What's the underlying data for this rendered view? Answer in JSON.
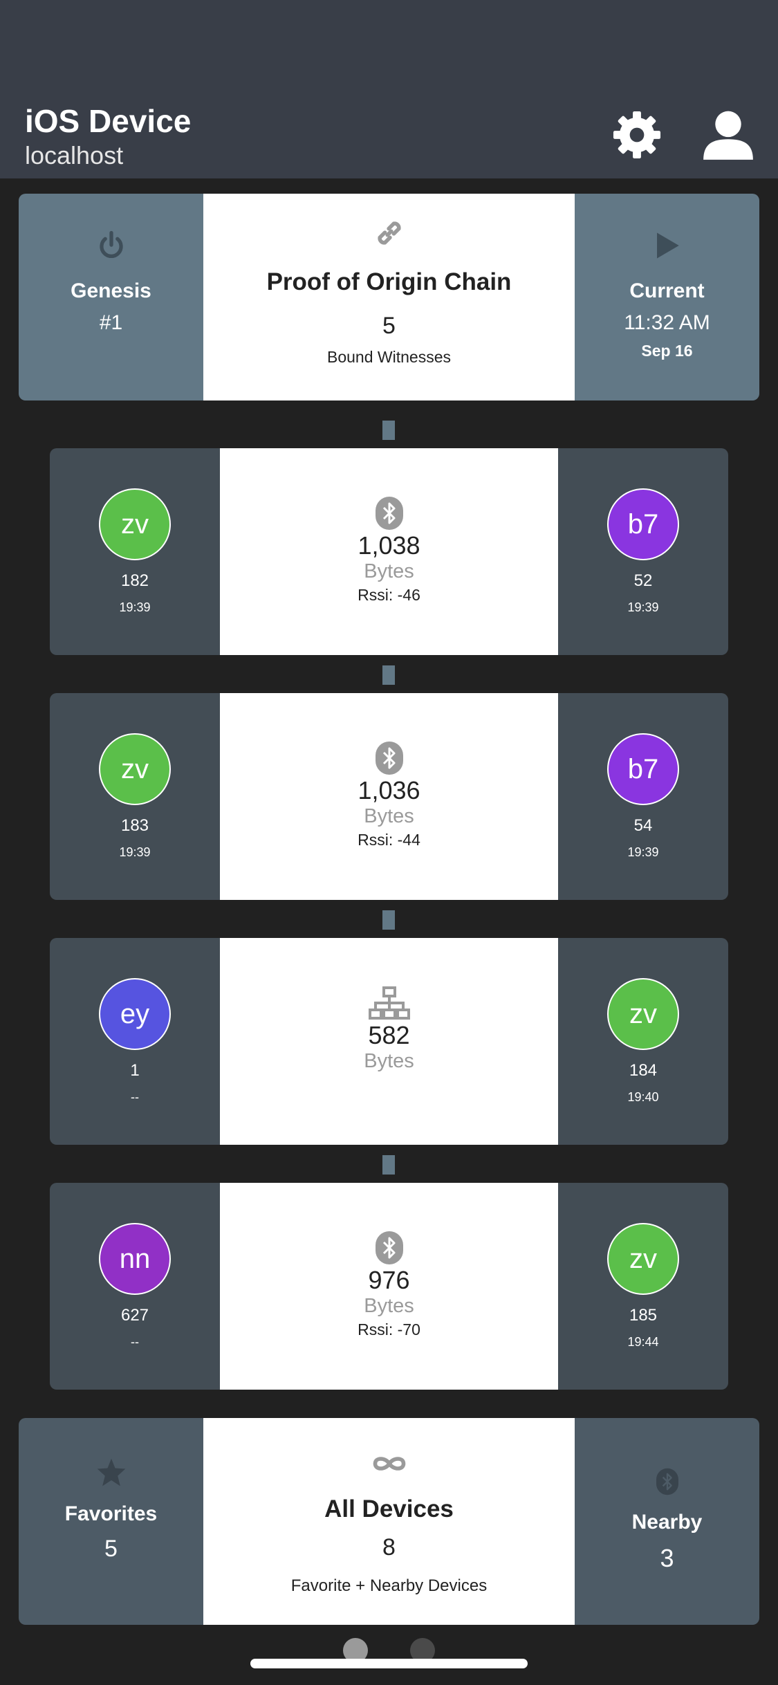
{
  "header": {
    "title": "iOS Device",
    "subtitle": "localhost"
  },
  "chain": {
    "left": {
      "label": "Genesis",
      "value": "#1"
    },
    "center": {
      "title": "Proof of Origin Chain",
      "count": "5",
      "caption": "Bound Witnesses"
    },
    "right": {
      "label": "Current",
      "time": "11:32 AM",
      "date": "Sep 16"
    }
  },
  "witnesses": [
    {
      "left": {
        "initials": "zv",
        "count": "182",
        "time": "19:39",
        "color": "#5bbf4a"
      },
      "icon": "bluetooth-icon",
      "bytes": "1,038",
      "bytes_label": "Bytes",
      "rssi": "Rssi: -46",
      "right": {
        "initials": "b7",
        "count": "52",
        "time": "19:39",
        "color": "#8a35e0"
      }
    },
    {
      "left": {
        "initials": "zv",
        "count": "183",
        "time": "19:39",
        "color": "#5bbf4a"
      },
      "icon": "bluetooth-icon",
      "bytes": "1,036",
      "bytes_label": "Bytes",
      "rssi": "Rssi: -44",
      "right": {
        "initials": "b7",
        "count": "54",
        "time": "19:39",
        "color": "#8a35e0"
      }
    },
    {
      "left": {
        "initials": "ey",
        "count": "1",
        "time": "--",
        "color": "#5654e0"
      },
      "icon": "network-icon",
      "bytes": "582",
      "bytes_label": "Bytes",
      "rssi": "",
      "right": {
        "initials": "zv",
        "count": "184",
        "time": "19:40",
        "color": "#5bbf4a"
      }
    },
    {
      "left": {
        "initials": "nn",
        "count": "627",
        "time": "--",
        "color": "#9130c6"
      },
      "icon": "bluetooth-icon",
      "bytes": "976",
      "bytes_label": "Bytes",
      "rssi": "Rssi: -70",
      "right": {
        "initials": "zv",
        "count": "185",
        "time": "19:44",
        "color": "#5bbf4a"
      }
    }
  ],
  "devices": {
    "left": {
      "label": "Favorites",
      "value": "5"
    },
    "center": {
      "title": "All Devices",
      "count": "8",
      "caption": "Favorite + Nearby Devices"
    },
    "right": {
      "label": "Nearby",
      "value": "3"
    }
  },
  "colors": {
    "header_bg": "#393e48",
    "page_bg": "#212121",
    "chain_side": "#627886",
    "witness_side": "#434d55"
  }
}
